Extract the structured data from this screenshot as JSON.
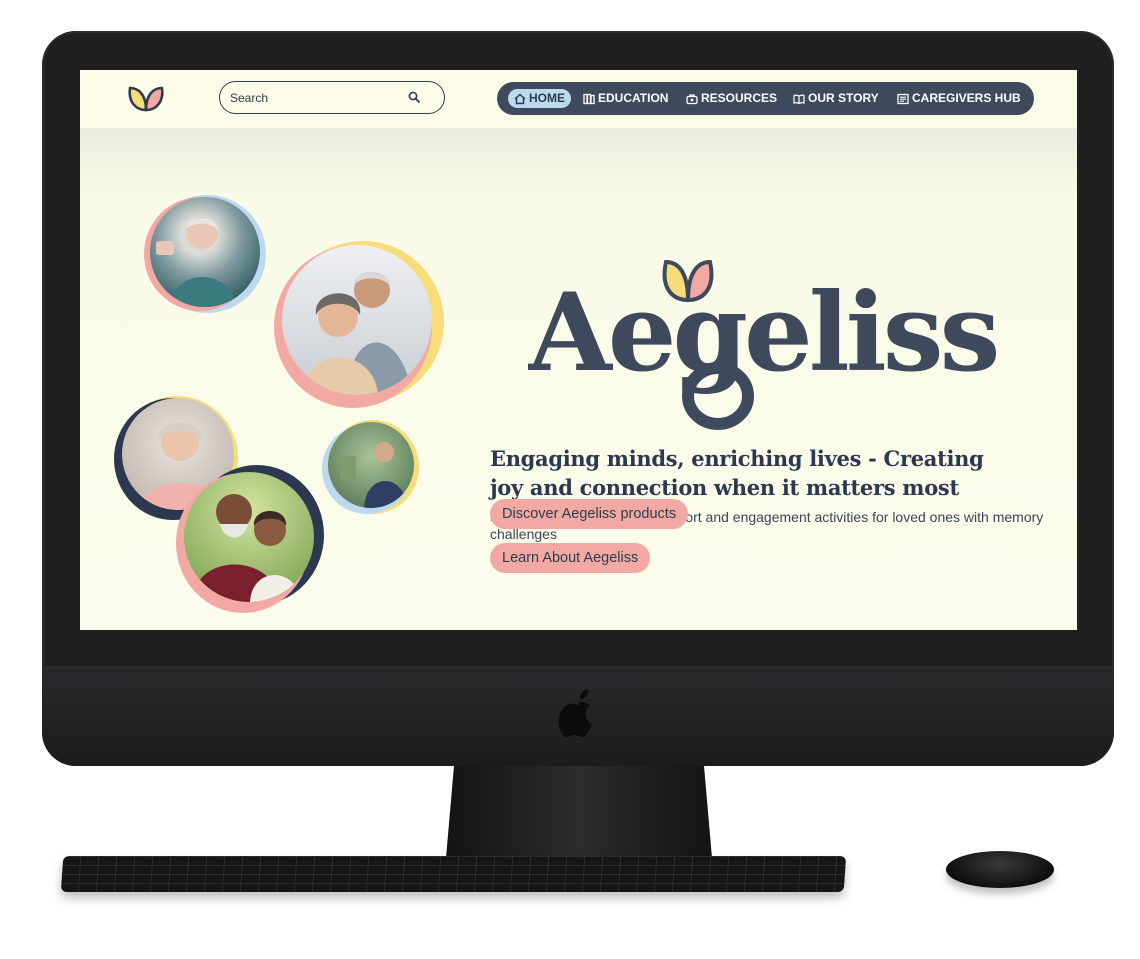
{
  "site": {
    "search": {
      "placeholder": "Search"
    },
    "nav": {
      "items": [
        {
          "label": "HOME",
          "icon": "home-icon",
          "active": true
        },
        {
          "label": "EDUCATION",
          "icon": "books-icon",
          "active": false
        },
        {
          "label": "RESOURCES",
          "icon": "toolbox-icon",
          "active": false
        },
        {
          "label": "OUR STORY",
          "icon": "open-book-icon",
          "active": false
        },
        {
          "label": "CAREGIVERS HUB",
          "icon": "newspaper-icon",
          "active": false
        }
      ]
    },
    "hero": {
      "brand_name": "Aegeliss",
      "headline": "Engaging minds, enriching lives - Creating joy and connection when it matters most",
      "subtext": "Simple, delightful memory support and engagement activities for loved ones with memory challenges",
      "primary_button": "Discover Aegeliss products",
      "secondary_button": "Learn About Aegeliss"
    }
  },
  "colors": {
    "background": "#fbfbe8",
    "navy": "#3e4a5c",
    "text_dark": "#2b3850",
    "accent_pink": "#f2a9a3",
    "accent_yellow": "#f7dc7a",
    "accent_blue": "#bcd9ee"
  },
  "device": {
    "logo": "apple-logo-icon"
  }
}
